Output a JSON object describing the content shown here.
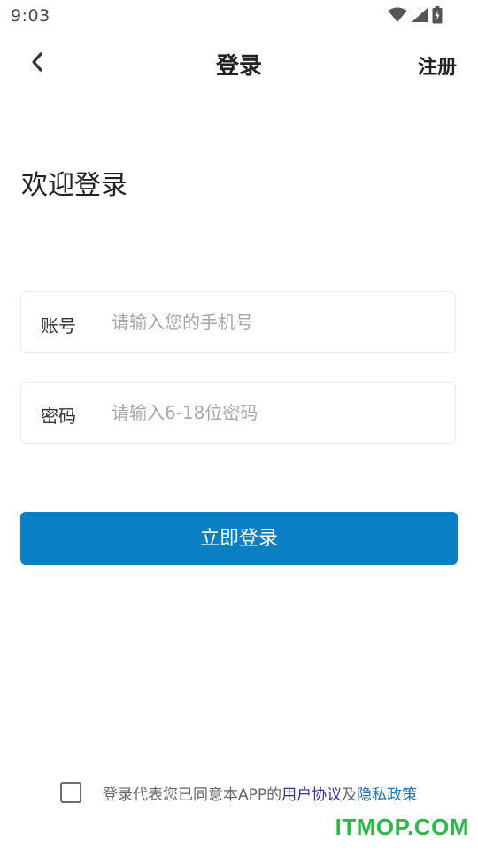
{
  "status_bar": {
    "time": "9:03",
    "icons": [
      "wifi-icon",
      "signal-icon",
      "battery-charging-icon"
    ]
  },
  "header": {
    "back_icon": "chevron-left-icon",
    "title": "登录",
    "register_label": "注册"
  },
  "welcome": {
    "text": "欢迎登录"
  },
  "form": {
    "account": {
      "label": "账号",
      "value": "",
      "placeholder": "请输入您的手机号"
    },
    "password": {
      "label": "密码",
      "value": "",
      "placeholder": "请输入6-18位密码"
    },
    "submit_label": "立即登录"
  },
  "agreement": {
    "checked": false,
    "prefix": "登录代表您已同意本APP的",
    "user_agreement": "用户协议",
    "conjunction": "及",
    "privacy_policy": "隐私政策"
  },
  "watermark": {
    "text": "ITMOP.COM"
  },
  "colors": {
    "primary": "#0a7fc4",
    "link_user_agreement": "#2f2fa8",
    "link_privacy": "#1c73b8",
    "watermark": "#2db84a"
  }
}
